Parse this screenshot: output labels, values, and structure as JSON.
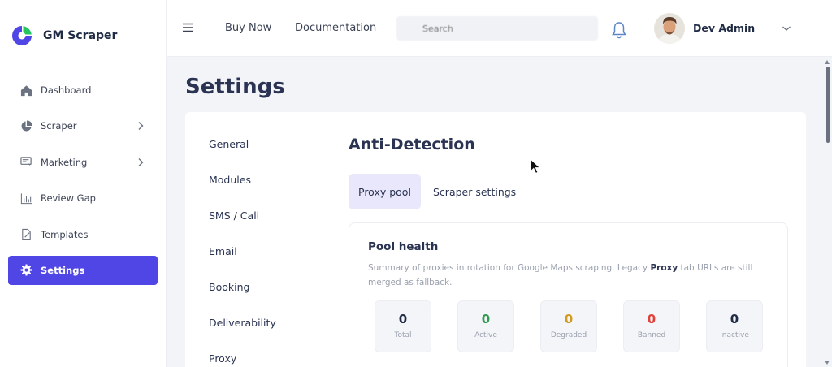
{
  "brand": {
    "name": "GM Scraper",
    "logo_icon": "gm-scraper-logo",
    "accent": "#5046e5"
  },
  "sidebar": {
    "items": [
      {
        "label": "Dashboard",
        "icon": "home-icon",
        "has_submenu": false,
        "active": false
      },
      {
        "label": "Scraper",
        "icon": "pie-chart-icon",
        "has_submenu": true,
        "active": false
      },
      {
        "label": "Marketing",
        "icon": "megaphone-icon",
        "has_submenu": true,
        "active": false
      },
      {
        "label": "Review Gap",
        "icon": "bar-chart-icon",
        "has_submenu": false,
        "active": false
      },
      {
        "label": "Templates",
        "icon": "edit-file-icon",
        "has_submenu": false,
        "active": false
      },
      {
        "label": "Settings",
        "icon": "gear-icon",
        "has_submenu": false,
        "active": true
      }
    ]
  },
  "topbar": {
    "menu_icon": "hamburger-icon",
    "buy_now": "Buy Now",
    "documentation": "Documentation",
    "search_placeholder": "Search",
    "notification_icon": "bell-icon",
    "user_name": "Dev Admin"
  },
  "page": {
    "title": "Settings"
  },
  "settings_nav": [
    "General",
    "Modules",
    "SMS / Call",
    "Email",
    "Booking",
    "Deliverability",
    "Proxy"
  ],
  "content": {
    "section_title": "Anti-Detection",
    "tabs": [
      {
        "label": "Proxy pool",
        "active": true
      },
      {
        "label": "Scraper settings",
        "active": false
      }
    ],
    "panel": {
      "title": "Pool health",
      "desc_before": "Summary of proxies in rotation for Google Maps scraping. Legacy ",
      "desc_bold": "Proxy",
      "desc_after": " tab URLs are still merged as fallback.",
      "stats": [
        {
          "value": "0",
          "label": "Total",
          "color": "#1f2a44"
        },
        {
          "value": "0",
          "label": "Active",
          "color": "#2e9b4f"
        },
        {
          "value": "0",
          "label": "Degraded",
          "color": "#d19a1d"
        },
        {
          "value": "0",
          "label": "Banned",
          "color": "#e0413b"
        },
        {
          "value": "0",
          "label": "Inactive",
          "color": "#1f2a44"
        }
      ]
    }
  }
}
